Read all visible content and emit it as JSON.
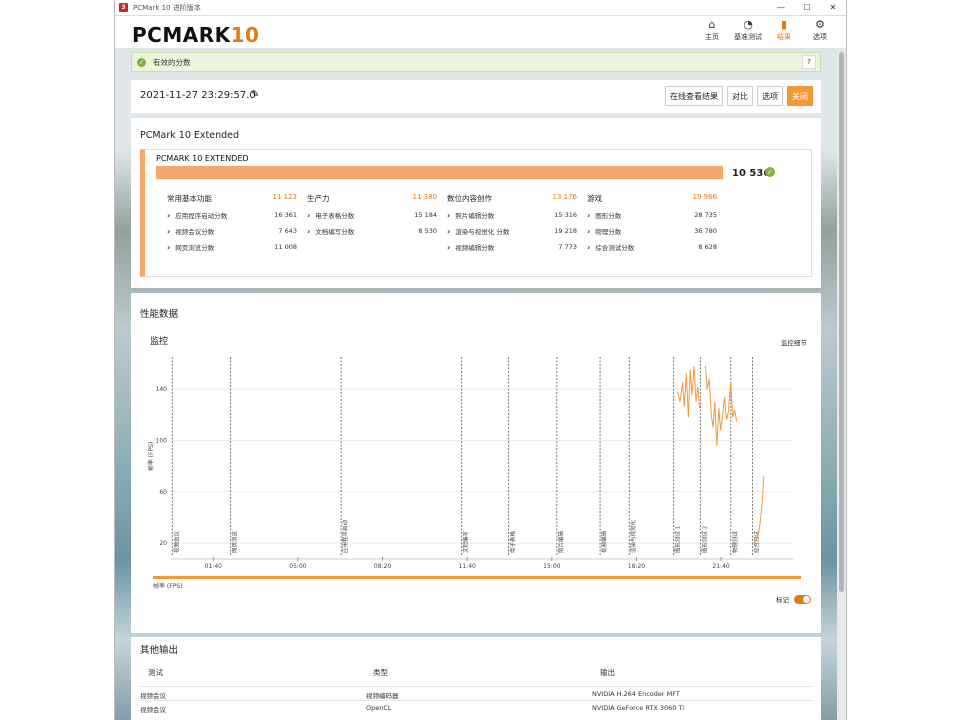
{
  "window": {
    "title": "PCMark 10 进阶版本"
  },
  "header": {
    "logo_text": "PCMARK",
    "logo_num": "10",
    "nav": [
      {
        "icon": "home-icon",
        "glyph": "⌂",
        "label": "主页",
        "active": false
      },
      {
        "icon": "gauge-icon",
        "glyph": "◔",
        "label": "基准测试",
        "active": false
      },
      {
        "icon": "bar-chart-icon",
        "glyph": "▮",
        "label": "结果",
        "active": true
      },
      {
        "icon": "gear-icon",
        "glyph": "⚙",
        "label": "选项",
        "active": false
      }
    ]
  },
  "valid": {
    "text": "有效的分数",
    "help": "?"
  },
  "result_header": {
    "datetime": "2021-11-27 23:29:57.0",
    "buttons": {
      "online": "在线查看结果",
      "compare": "对比",
      "options": "选项",
      "close": "关闭"
    }
  },
  "result": {
    "section_title": "PCMark 10 Extended",
    "name": "PCMARK 10 EXTENDED",
    "total": "10 536",
    "categories": [
      {
        "name": "常用基本功能",
        "score": "11 123",
        "items": [
          {
            "label": "应用程序启动分数",
            "value": "16 361"
          },
          {
            "label": "视频会议分数",
            "value": "7 643"
          },
          {
            "label": "网页浏览分数",
            "value": "11 008"
          }
        ]
      },
      {
        "name": "生产力",
        "score": "11 380",
        "items": [
          {
            "label": "电子表格分数",
            "value": "15 184"
          },
          {
            "label": "文档编写分数",
            "value": "8 530"
          }
        ]
      },
      {
        "name": "数位内容创作",
        "score": "13 176",
        "items": [
          {
            "label": "照片编辑分数",
            "value": "15 316"
          },
          {
            "label": "渲染与视觉化 分数",
            "value": "19 218"
          },
          {
            "label": "视频编辑分数",
            "value": "7 773"
          }
        ]
      },
      {
        "name": "游戏",
        "score": "19 966",
        "items": [
          {
            "label": "图形分数",
            "value": "28 735"
          },
          {
            "label": "物理分数",
            "value": "36 780"
          },
          {
            "label": "综合测试分数",
            "value": "8 628"
          }
        ]
      }
    ]
  },
  "performance": {
    "section_title": "性能数据",
    "monitor_label": "监控",
    "monitor_detail": "监控细节",
    "marker_label": "标记",
    "legend_label": "帧率 (FPS)"
  },
  "chart_data": {
    "type": "line",
    "title": "",
    "ylabel": "帧率 (FPS)",
    "xlabel": "",
    "ylim": [
      10,
      165
    ],
    "xlim": [
      0,
      24.5
    ],
    "yticks": [
      20,
      60,
      100,
      140
    ],
    "xticks": [
      {
        "v": 1.667,
        "label": "01:40"
      },
      {
        "v": 5.0,
        "label": "05:00"
      },
      {
        "v": 8.333,
        "label": "08:20"
      },
      {
        "v": 11.667,
        "label": "11:40"
      },
      {
        "v": 15.0,
        "label": "15:00"
      },
      {
        "v": 18.333,
        "label": "18:20"
      },
      {
        "v": 21.667,
        "label": "21:40"
      }
    ],
    "grid": true,
    "markers": [
      {
        "x": 0.05,
        "label": "视频会议"
      },
      {
        "x": 2.35,
        "label": "网页浏览"
      },
      {
        "x": 6.7,
        "label": "应用程序启动"
      },
      {
        "x": 11.45,
        "label": "文档编写"
      },
      {
        "x": 13.3,
        "label": "电子表格"
      },
      {
        "x": 15.2,
        "label": "照片编辑"
      },
      {
        "x": 16.9,
        "label": "视频编辑"
      },
      {
        "x": 18.05,
        "label": "渲染与视觉化"
      },
      {
        "x": 19.8,
        "label": "图形测试 1"
      },
      {
        "x": 20.85,
        "label": "图形测试 2"
      },
      {
        "x": 22.05,
        "label": "物理测试"
      },
      {
        "x": 22.9,
        "label": "综合测试"
      }
    ],
    "series": [
      {
        "name": "帧率 (FPS)",
        "segments": [
          [
            [
              19.95,
              138
            ],
            [
              20.05,
              130
            ],
            [
              20.15,
              145
            ],
            [
              20.22,
              126
            ],
            [
              20.3,
              152
            ],
            [
              20.38,
              118
            ],
            [
              20.45,
              155
            ],
            [
              20.52,
              135
            ],
            [
              20.6,
              158
            ],
            [
              20.68,
              130
            ],
            [
              20.75,
              142
            ],
            [
              20.82,
              125
            ]
          ],
          [
            [
              21.05,
              158
            ],
            [
              21.12,
              140
            ],
            [
              21.2,
              148
            ],
            [
              21.28,
              120
            ],
            [
              21.35,
              110
            ],
            [
              21.42,
              130
            ],
            [
              21.5,
              96
            ],
            [
              21.58,
              125
            ],
            [
              21.65,
              108
            ],
            [
              21.72,
              118
            ],
            [
              21.8,
              134
            ],
            [
              21.88,
              116
            ],
            [
              21.95,
              122
            ],
            [
              22.05,
              146
            ],
            [
              22.12,
              118
            ],
            [
              22.2,
              124
            ],
            [
              22.28,
              115
            ]
          ],
          [
            [
              22.95,
              20
            ],
            [
              23.05,
              22
            ],
            [
              23.15,
              28
            ],
            [
              23.22,
              38
            ],
            [
              23.3,
              55
            ],
            [
              23.35,
              72
            ]
          ]
        ]
      }
    ]
  },
  "other_output": {
    "section_title": "其他输出",
    "columns": [
      "测试",
      "类型",
      "输出"
    ],
    "rows": [
      {
        "test": "视频会议",
        "type": "视频编码器",
        "output": "NVIDIA H.264 Encoder MFT"
      },
      {
        "test": "视频会议",
        "type": "OpenCL",
        "output": "NVIDIA GeForce RTX 3060 Ti"
      }
    ]
  }
}
